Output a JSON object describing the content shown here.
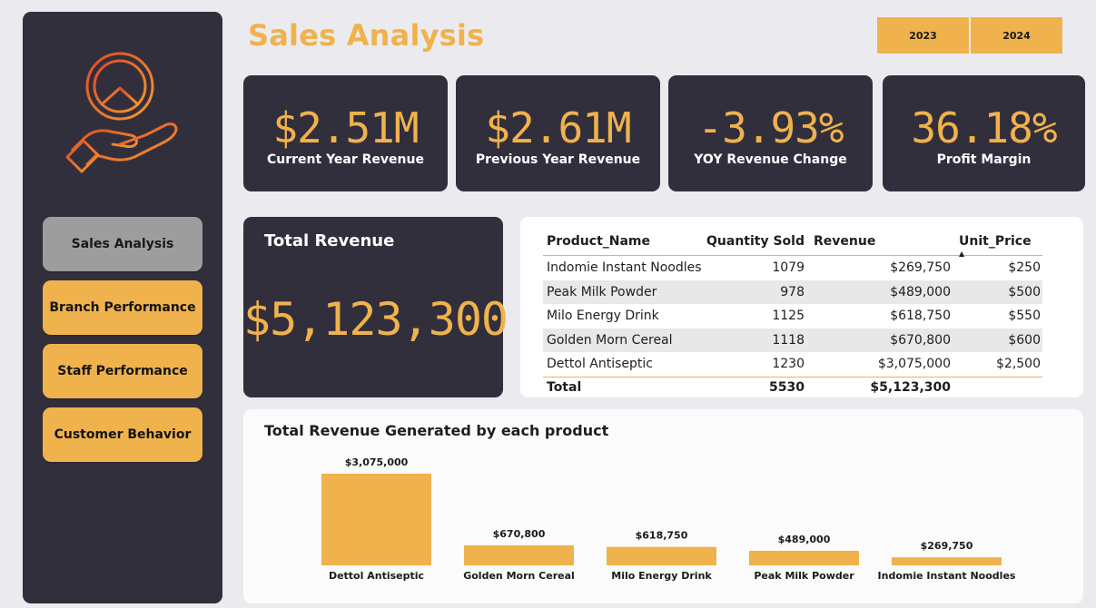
{
  "page": {
    "title": "Sales Analysis"
  },
  "colors": {
    "accent": "#f0b24c",
    "panel": "#322f3d",
    "background": "#ebebef",
    "active_nav": "#9d9d9d"
  },
  "sidebar": {
    "logo_icon": "peace-sign-hand-icon",
    "nav": [
      {
        "label": "Sales Analysis",
        "active": true
      },
      {
        "label": "Branch Performance",
        "active": false
      },
      {
        "label": "Staff Performance",
        "active": false
      },
      {
        "label": "Customer Behavior",
        "active": false
      }
    ]
  },
  "years": [
    "2023",
    "2024"
  ],
  "kpis": [
    {
      "value": "$2.51M",
      "label": "Current Year Revenue"
    },
    {
      "value": "$2.61M",
      "label": "Previous Year Revenue"
    },
    {
      "value": "-3.93%",
      "label": "YOY Revenue Change"
    },
    {
      "value": "36.18%",
      "label": "Profit Margin"
    }
  ],
  "total_revenue": {
    "title": "Total Revenue",
    "value": "$5,123,300"
  },
  "table": {
    "headers": [
      "Product_Name",
      "Quantity Sold",
      "Revenue",
      "Unit_Price"
    ],
    "sorted_by": "Unit_Price",
    "rows": [
      [
        "Indomie Instant Noodles",
        "1079",
        "$269,750",
        "$250"
      ],
      [
        "Peak Milk Powder",
        "978",
        "$489,000",
        "$500"
      ],
      [
        "Milo Energy Drink",
        "1125",
        "$618,750",
        "$550"
      ],
      [
        "Golden Morn Cereal",
        "1118",
        "$670,800",
        "$600"
      ],
      [
        "Dettol Antiseptic",
        "1230",
        "$3,075,000",
        "$2,500"
      ]
    ],
    "total": [
      "Total",
      "5530",
      "$5,123,300",
      ""
    ]
  },
  "chart_data": {
    "type": "bar",
    "title": "Total Revenue Generated by each product",
    "categories": [
      "Dettol Antiseptic",
      "Golden Morn Cereal",
      "Milo Energy Drink",
      "Peak Milk Powder",
      "Indomie Instant Noodles"
    ],
    "values": [
      3075000,
      670800,
      618750,
      489000,
      269750
    ],
    "data_labels": [
      "$3,075,000",
      "$670,800",
      "$618,750",
      "$489,000",
      "$269,750"
    ],
    "color": "#f0b24c",
    "xlabel": "",
    "ylabel": "",
    "ylim": [
      0,
      3075000
    ],
    "grid": false,
    "legend": "none"
  }
}
